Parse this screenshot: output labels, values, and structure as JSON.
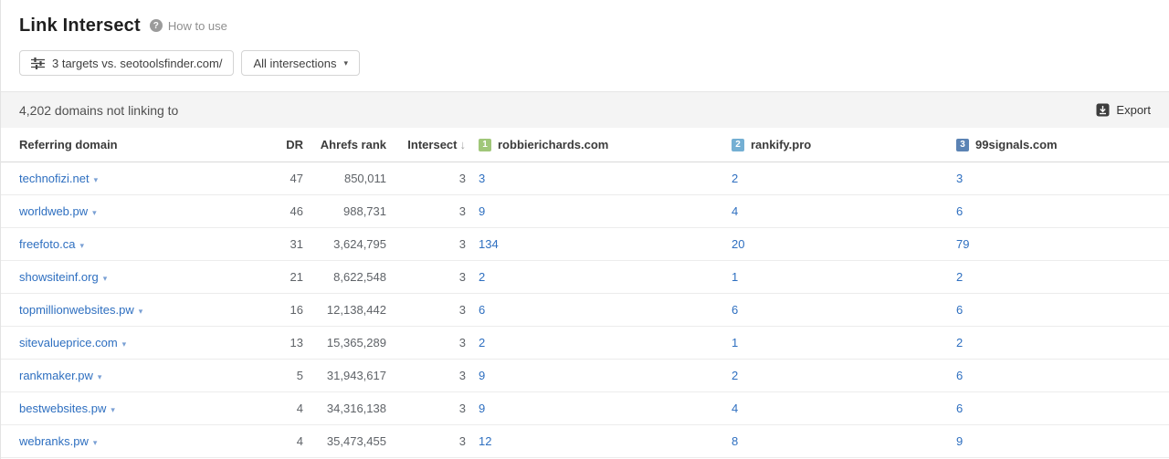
{
  "page": {
    "title": "Link Intersect",
    "help_link": "How to use"
  },
  "toolbar": {
    "targets_button": "3 targets vs. seotoolsfinder.com/",
    "intersections_dropdown": "All intersections"
  },
  "results_bar": {
    "summary": "4,202 domains not linking to",
    "export_label": "Export"
  },
  "icons": {
    "question": "?",
    "caret_down": "▾",
    "sort_desc": "↓"
  },
  "table": {
    "headers": {
      "referring_domain": "Referring domain",
      "dr": "DR",
      "ahrefs_rank": "Ahrefs rank",
      "intersect": "Intersect",
      "targets": [
        {
          "index": "1",
          "domain": "robbierichards.com",
          "color": "#a0c779"
        },
        {
          "index": "2",
          "domain": "rankify.pro",
          "color": "#74afd3"
        },
        {
          "index": "3",
          "domain": "99signals.com",
          "color": "#5b83b4"
        }
      ]
    },
    "rows": [
      {
        "domain": "technofizi.net",
        "dr": "47",
        "rank": "850,011",
        "intersect": "3",
        "t1": "3",
        "t2": "2",
        "t3": "3"
      },
      {
        "domain": "worldweb.pw",
        "dr": "46",
        "rank": "988,731",
        "intersect": "3",
        "t1": "9",
        "t2": "4",
        "t3": "6"
      },
      {
        "domain": "freefoto.ca",
        "dr": "31",
        "rank": "3,624,795",
        "intersect": "3",
        "t1": "134",
        "t2": "20",
        "t3": "79"
      },
      {
        "domain": "showsiteinf.org",
        "dr": "21",
        "rank": "8,622,548",
        "intersect": "3",
        "t1": "2",
        "t2": "1",
        "t3": "2"
      },
      {
        "domain": "topmillionwebsites.pw",
        "dr": "16",
        "rank": "12,138,442",
        "intersect": "3",
        "t1": "6",
        "t2": "6",
        "t3": "6"
      },
      {
        "domain": "sitevalueprice.com",
        "dr": "13",
        "rank": "15,365,289",
        "intersect": "3",
        "t1": "2",
        "t2": "1",
        "t3": "2"
      },
      {
        "domain": "rankmaker.pw",
        "dr": "5",
        "rank": "31,943,617",
        "intersect": "3",
        "t1": "9",
        "t2": "2",
        "t3": "6"
      },
      {
        "domain": "bestwebsites.pw",
        "dr": "4",
        "rank": "34,316,138",
        "intersect": "3",
        "t1": "9",
        "t2": "4",
        "t3": "6"
      },
      {
        "domain": "webranks.pw",
        "dr": "4",
        "rank": "35,473,455",
        "intersect": "3",
        "t1": "12",
        "t2": "8",
        "t3": "9"
      }
    ]
  }
}
